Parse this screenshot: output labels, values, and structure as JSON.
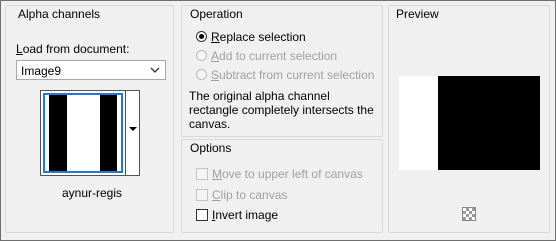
{
  "alpha_channels": {
    "title": "Alpha channels",
    "load_label_pre": "L",
    "load_label_rest": "oad from document:",
    "document_value": "Image9",
    "channel_name": "aynur-regis"
  },
  "operation": {
    "title": "Operation",
    "replace": {
      "u": "R",
      "rest": "eplace selection",
      "selected": true
    },
    "add": {
      "u": "A",
      "rest": "dd to current selection",
      "enabled": false
    },
    "subtract": {
      "u": "S",
      "rest": "ubtract from current selection",
      "enabled": false
    },
    "description_line1": "The original alpha channel",
    "description_line2": "rectangle completely intersects the",
    "description_line3": "canvas."
  },
  "options": {
    "title": "Options",
    "move": {
      "u": "M",
      "rest": "ove to upper left of canvas",
      "checked": false,
      "enabled": false
    },
    "clip": {
      "u": "C",
      "rest": "lip to canvas",
      "checked": false,
      "enabled": false
    },
    "invert": {
      "u": "I",
      "rest": "nvert image",
      "checked": false,
      "enabled": true
    }
  },
  "preview": {
    "title": "Preview"
  },
  "colors": {
    "panel_bg": "#f0f0f0",
    "thumb_border_selected": "#1e7bd6",
    "disabled_text": "#a0a0a0"
  }
}
